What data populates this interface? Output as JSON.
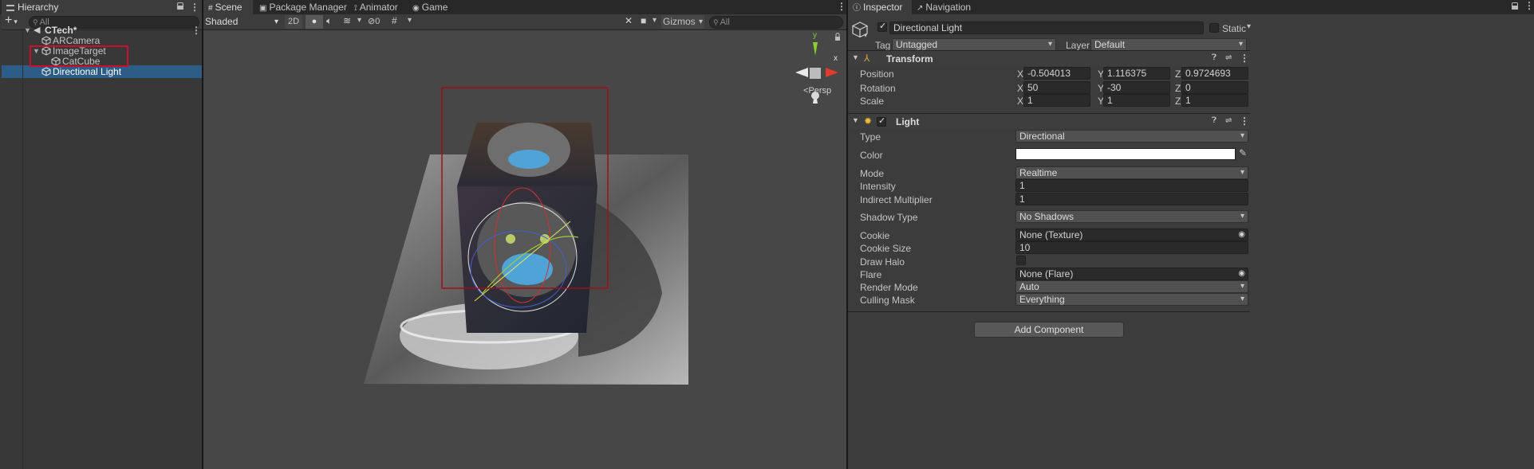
{
  "hierarchy": {
    "tab_label": "Hierarchy",
    "search_placeholder": "All",
    "add_label": "+",
    "scene_name": "CTech*",
    "items": [
      {
        "label": "ARCamera"
      },
      {
        "label": "ImageTarget"
      },
      {
        "label": "CatCube"
      },
      {
        "label": "Directional Light"
      }
    ]
  },
  "scene": {
    "tabs": [
      {
        "label": "Scene"
      },
      {
        "label": "Package Manager"
      },
      {
        "label": "Animator"
      },
      {
        "label": "Game"
      }
    ],
    "toolbar": {
      "shading_mode": "Shaded",
      "mode_2d": "2D",
      "hidden_count": "0",
      "gizmos_label": "Gizmos",
      "search_placeholder": "All"
    },
    "gizmo": {
      "y_label": "y",
      "x_label": "x",
      "persp_label": "Persp"
    }
  },
  "inspector": {
    "tabs": [
      {
        "label": "Inspector"
      },
      {
        "label": "Navigation"
      }
    ],
    "object_name": "Directional Light",
    "static_label": "Static",
    "tag_label": "Tag",
    "tag_value": "Untagged",
    "layer_label": "Layer",
    "layer_value": "Default",
    "transform": {
      "title": "Transform",
      "position_label": "Position",
      "rotation_label": "Rotation",
      "scale_label": "Scale",
      "axis_x": "X",
      "axis_y": "Y",
      "axis_z": "Z",
      "position": {
        "x": "-0.504013",
        "y": "1.116375",
        "z": "0.9724693"
      },
      "rotation": {
        "x": "50",
        "y": "-30",
        "z": "0"
      },
      "scale": {
        "x": "1",
        "y": "1",
        "z": "1"
      }
    },
    "light": {
      "title": "Light",
      "type_label": "Type",
      "type_value": "Directional",
      "color_label": "Color",
      "color_value": "#ffffff",
      "mode_label": "Mode",
      "mode_value": "Realtime",
      "intensity_label": "Intensity",
      "intensity_value": "1",
      "indirect_label": "Indirect Multiplier",
      "indirect_value": "1",
      "shadow_label": "Shadow Type",
      "shadow_value": "No Shadows",
      "cookie_label": "Cookie",
      "cookie_value": "None (Texture)",
      "cookie_size_label": "Cookie Size",
      "cookie_size_value": "10",
      "draw_halo_label": "Draw Halo",
      "draw_halo_checked": false,
      "flare_label": "Flare",
      "flare_value": "None (Flare)",
      "render_mode_label": "Render Mode",
      "render_mode_value": "Auto",
      "culling_label": "Culling Mask",
      "culling_value": "Everything"
    },
    "add_component_label": "Add Component"
  },
  "colors": {
    "selection": "#2c5d87",
    "highlight_box": "#c8102e",
    "scene_bg": "#474747"
  }
}
